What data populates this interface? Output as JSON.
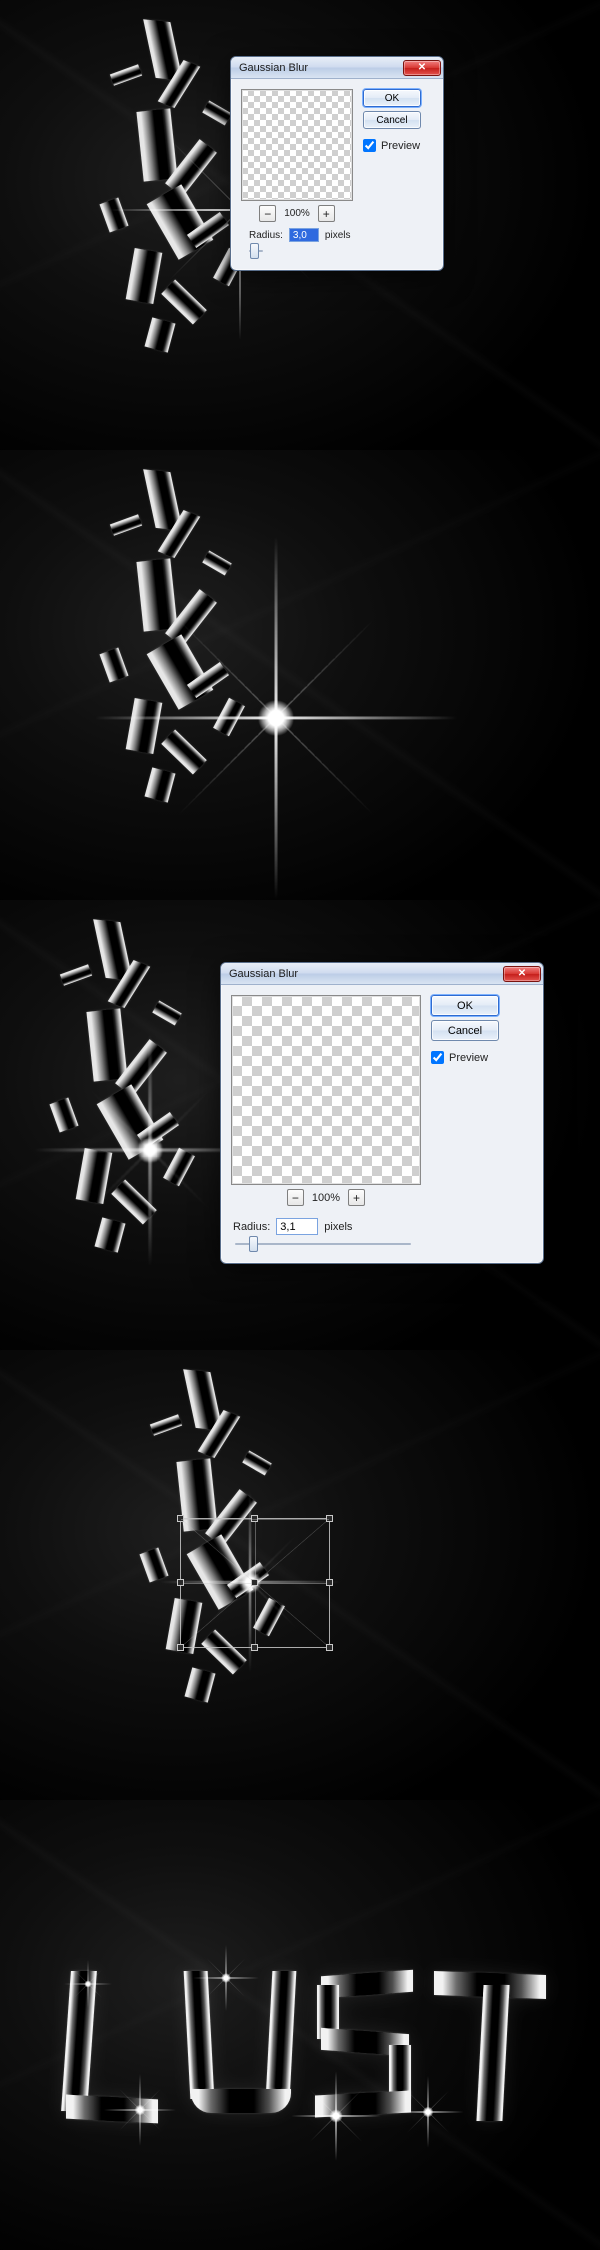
{
  "dialog_small": {
    "title": "Gaussian Blur",
    "ok": "OK",
    "cancel": "Cancel",
    "preview_label": "Preview",
    "preview_checked": true,
    "zoom_percent": "100%",
    "zoom_minus": "−",
    "zoom_plus": "+",
    "radius_label": "Radius:",
    "radius_value": "3,0",
    "radius_unit": "pixels",
    "slider_pos_pct": 6
  },
  "dialog_large": {
    "title": "Gaussian Blur",
    "ok": "OK",
    "cancel": "Cancel",
    "preview_label": "Preview",
    "preview_checked": true,
    "zoom_percent": "100%",
    "zoom_minus": "−",
    "zoom_plus": "+",
    "radius_label": "Radius:",
    "radius_value": "3,1",
    "radius_unit": "pixels",
    "slider_pos_pct": 8
  },
  "close_glyph": "✕",
  "word": "LUST"
}
